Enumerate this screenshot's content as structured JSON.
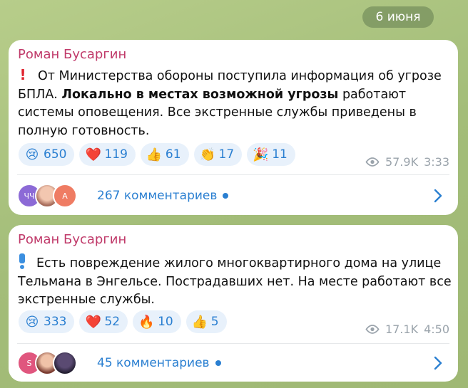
{
  "date_label": "6 июня",
  "messages": [
    {
      "author": "Роман Бусаргин",
      "text_before_bold": "От Министерства обороны поступила информация об угрозе БПЛА. ",
      "text_bold": "Локально в местах возможной угрозы",
      "text_after_bold": " работают системы оповещения. Все экстренные службы приведены в полную готовность.",
      "reactions": [
        {
          "emoji": "😢",
          "count": "650"
        },
        {
          "emoji": "❤️",
          "count": "119"
        },
        {
          "emoji": "👍",
          "count": "61"
        },
        {
          "emoji": "👏",
          "count": "17"
        },
        {
          "emoji": "🎉",
          "count": "11"
        }
      ],
      "views": "57.9K",
      "time": "3:33",
      "comments_label": "267 комментариев",
      "avatars": [
        "ЧЧ",
        "",
        "А"
      ]
    },
    {
      "author": "Роман Бусаргин",
      "text": "Есть повреждение жилого многоквартирного дома на улице Тельмана в Энгельсе. Пострадавших нет. На месте работают все экстренные службы.",
      "reactions": [
        {
          "emoji": "😢",
          "count": "333"
        },
        {
          "emoji": "❤️",
          "count": "52"
        },
        {
          "emoji": "🔥",
          "count": "10"
        },
        {
          "emoji": "👍",
          "count": "5"
        }
      ],
      "views": "17.1K",
      "time": "4:50",
      "comments_label": "45 комментариев",
      "avatars": [
        "S",
        "",
        ""
      ]
    }
  ],
  "colors": {
    "author": "#c03a6a",
    "accent": "#2a7fd1",
    "reaction_bg": "#e8f1fb",
    "meta": "#9aa3ab"
  }
}
